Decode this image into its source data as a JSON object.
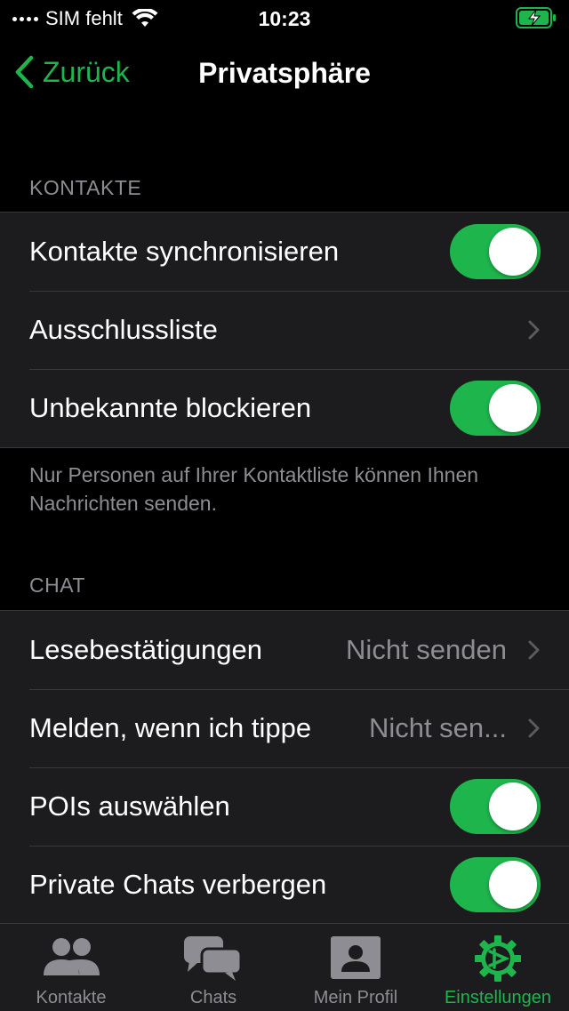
{
  "status_bar": {
    "carrier": "SIM fehlt",
    "time": "10:23"
  },
  "nav": {
    "back_label": "Zurück",
    "title": "Privatsphäre"
  },
  "sections": {
    "contacts": {
      "header": "KONTAKTE",
      "rows": [
        {
          "label": "Kontakte synchronisieren",
          "control": "toggle",
          "on": true
        },
        {
          "label": "Ausschlussliste",
          "control": "disclosure"
        },
        {
          "label": "Unbekannte blockieren",
          "control": "toggle",
          "on": true
        }
      ],
      "footer": "Nur Personen auf Ihrer Kontaktliste können Ihnen Nachrichten senden."
    },
    "chat": {
      "header": "CHAT",
      "rows": [
        {
          "label": "Lesebestätigungen",
          "value": "Nicht senden",
          "control": "disclosure"
        },
        {
          "label": "Melden, wenn ich tippe",
          "value": "Nicht sen...",
          "control": "disclosure"
        },
        {
          "label": "POIs auswählen",
          "control": "toggle",
          "on": true
        },
        {
          "label": "Private Chats verbergen",
          "control": "toggle",
          "on": true
        }
      ]
    }
  },
  "tab_bar": {
    "tabs": [
      {
        "label": "Kontakte",
        "icon": "contacts-icon",
        "active": false
      },
      {
        "label": "Chats",
        "icon": "chats-icon",
        "active": false
      },
      {
        "label": "Mein Profil",
        "icon": "profile-icon",
        "active": false
      },
      {
        "label": "Einstellungen",
        "icon": "settings-gear-icon",
        "active": true
      }
    ]
  },
  "colors": {
    "accent": "#1db54c",
    "background": "#000000",
    "cell": "#1c1c1e",
    "secondary_text": "#8d8d93"
  }
}
